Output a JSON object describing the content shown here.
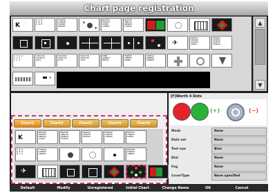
{
  "window": {
    "title": "Chart page registration"
  },
  "chart_grid": {
    "rows": [
      [
        "K-letters",
        "text-chart-1",
        "text-chart-2",
        "dots-cluster",
        "text-chart-3",
        "text-chart-4",
        "red-green",
        "dots-pattern-2",
        "grid-pattern",
        "diag-dots"
      ],
      [
        "target-square",
        "target-square-2",
        "center-dot",
        "cross-chart",
        "cross-chart-2",
        "dots-row",
        "red-cross",
        "bird-chart",
        "text-chart-5",
        "text-chart-6"
      ],
      [
        "numbers-chart",
        "numbers-chart-2",
        "numbers-chart-3",
        "numbers-chart-4",
        "text-chart-7",
        "text-chart-8",
        "text-chart-9",
        "white-cross",
        "ring-dots",
        "triangle-mark"
      ],
      [
        "wave-chart",
        "contrast-chart"
      ]
    ]
  },
  "tabs": [
    {
      "label": "Chart1",
      "active": true
    },
    {
      "label": "Chart2",
      "active": false
    },
    {
      "label": "Chart3",
      "active": false
    },
    {
      "label": "Chart4",
      "active": false
    },
    {
      "label": "Chart5",
      "active": false
    }
  ],
  "info": {
    "chart_name": "[F]Worth 4 Dots",
    "attributes": [
      {
        "label": "Mask",
        "value": "None"
      },
      {
        "label": "Data set",
        "value": "None"
      },
      {
        "label": "Test eye",
        "value": "Bino"
      },
      {
        "label": "Dial",
        "value": "None"
      },
      {
        "label": "Fog",
        "value": "None"
      },
      {
        "label": "CoverType",
        "value": "None specified"
      }
    ],
    "cross_plus": "(+)",
    "cross_minus": "(−)"
  },
  "buttons": [
    "Default",
    "Modify",
    "Unregistered",
    "Initial Chart",
    "Change Name",
    "OK",
    "Cancel"
  ],
  "colors": {
    "accent_pink": "#d0316b",
    "tab_orange": "#e8871a",
    "green_cross": "#3fb34a",
    "red_cross": "#e0402a"
  }
}
